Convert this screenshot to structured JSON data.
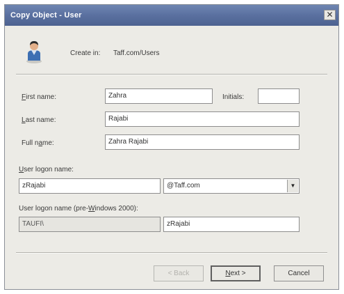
{
  "window": {
    "title": "Copy Object - User",
    "close_glyph": "✕"
  },
  "header": {
    "icon": "user-icon",
    "create_in_label": "Create in:",
    "create_in_value": "Taff.com/Users"
  },
  "form": {
    "first_name": {
      "label_mnemonic": "F",
      "label_rest": "irst name:",
      "value": "Zahra"
    },
    "initials": {
      "label": "Initials:",
      "value": ""
    },
    "last_name": {
      "label_mnemonic": "L",
      "label_rest": "ast name:",
      "value": "Rajabi"
    },
    "full_name": {
      "label_pre": "Full n",
      "label_mnemonic": "a",
      "label_rest": "me:",
      "value": "Zahra Rajabi"
    },
    "user_logon_name": {
      "label_mnemonic": "U",
      "label_rest": "ser logon name:",
      "value": "zRajabi",
      "domain_value": "@Taff.com",
      "dropdown_glyph": "▼"
    },
    "pre_windows_2000": {
      "label_pre": "User logon name (pre-",
      "label_mnemonic": "W",
      "label_rest": "indows 2000):",
      "domain_value": "TAUFI\\",
      "value": "zRajabi"
    }
  },
  "buttons": {
    "back_label": "< Back",
    "next_label_mnemonic": "N",
    "next_label_rest": "ext >",
    "cancel_label": "Cancel"
  },
  "colors": {
    "titlebar": "#5a70a0",
    "dialog_bg": "#ecebe6",
    "field_bg": "#ffffff"
  }
}
